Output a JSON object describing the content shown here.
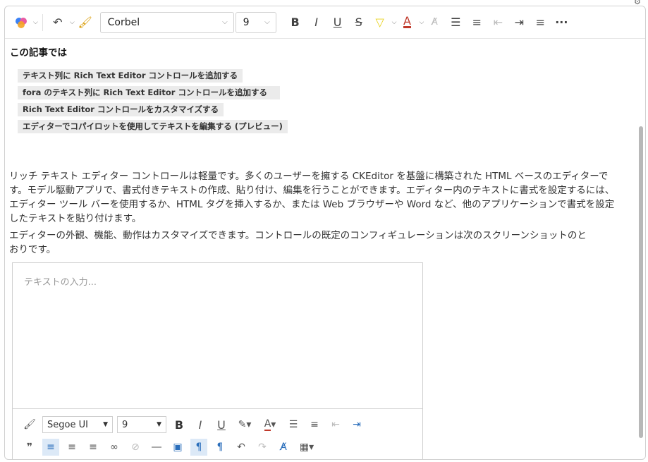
{
  "toolbar": {
    "font_name": "Corbel",
    "font_size": "9",
    "buttons": [
      "B",
      "I",
      "U",
      "S"
    ]
  },
  "content": {
    "heading": "この記事では",
    "toc": [
      "テキスト列に Rich Text Editor コントロールを追加する",
      "fora のテキスト列に Rich Text Editor コントロールを追加する",
      "Rich Text Editor コントロールをカスタマイズする",
      "エディターでコパイロットを使用してテキストを編集する (プレビュー)"
    ],
    "paragraph1": "リッチ テキスト エディター コントロールは軽量です。多くのユーザーを擁する CKEditor を基盤に構築された HTML ベースのエディターです。モデル駆動アプリで、書式付きテキストの作成、貼り付け、編集を行うことができます。エディター内のテキストに書式を設定するには、エディター ツール バーを使用するか、HTML タグを挿入するか、または Web ブラウザーや Word など、他のアプリケーションで書式を設定したテキストを貼り付けます。",
    "paragraph2": "エディターの外観、機能、動作はカスタマイズできます。コントロールの既定のコンフィギュレーションは次のスクリーンショットのとおりです。"
  },
  "editor": {
    "placeholder": "テキストの入力...",
    "font_name": "Segoe UI",
    "font_size": "9",
    "buttons": [
      "B",
      "I",
      "U"
    ]
  },
  "colors": {
    "highlight": "#e8d21d",
    "font_color": "#c0392b",
    "accent": "#2a6ebb"
  }
}
